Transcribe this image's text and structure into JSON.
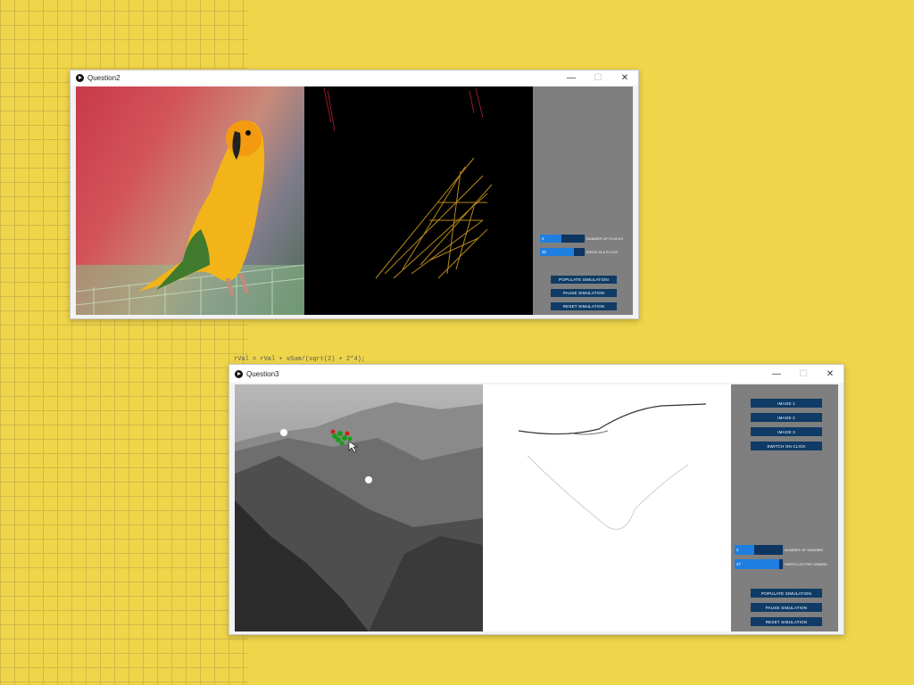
{
  "windows": {
    "question2": {
      "title": "Question2",
      "controls": {
        "minimize": "—",
        "maximize": "☐",
        "close": "✕"
      },
      "sliders": [
        {
          "value": "2",
          "label": "NUMBER OF FLOCKS"
        },
        {
          "value": "30",
          "label": "BIRDS IN A FLOCK"
        }
      ],
      "buttons": [
        "POPULATE SIMULATION",
        "PAUSE SIMULATION",
        "RESET SIMULATION"
      ]
    },
    "question3": {
      "title": "Question3",
      "controls": {
        "minimize": "—",
        "maximize": "☐",
        "close": "✕"
      },
      "image_buttons": [
        "IMAGE 1",
        "IMAGE 2",
        "IMAGE 3",
        "SWITCH ON CLICK"
      ],
      "sliders": [
        {
          "value": "2",
          "label": "NUMBER OF SWARMS"
        },
        {
          "value": "27",
          "label": "PARTICLES PER SWARM"
        }
      ],
      "buttons": [
        "POPULATE SIMULATION",
        "PAUSE SIMULATION",
        "RESET SIMULATION"
      ]
    }
  },
  "background_code": {
    "line": "rVal = rVal + vSum/(sqrt(2) + 2*4);"
  },
  "colors": {
    "background": "#efd54a",
    "panel": "#7f7f7f",
    "button": "#0f3b66",
    "slider_fill": "#1f7fe0"
  }
}
